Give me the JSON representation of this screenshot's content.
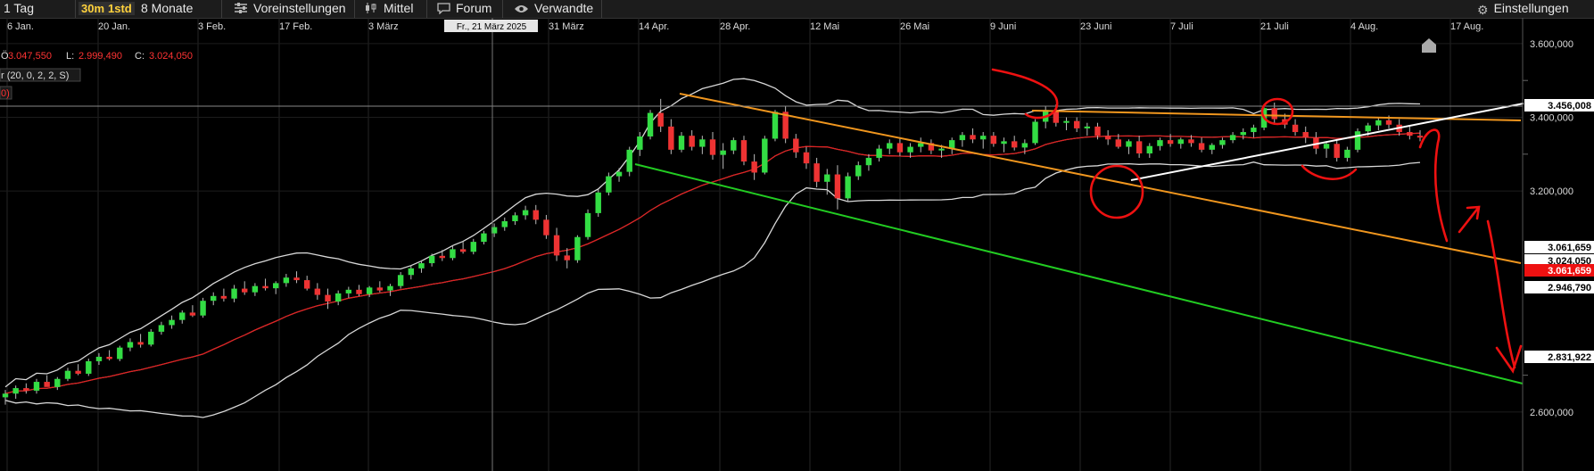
{
  "toolbar": {
    "period": "1 Tag",
    "interval_30m": "30m",
    "interval_1std": "1std",
    "range": "8 Monate",
    "presets": "Voreinstellungen",
    "indicator": "Mittel",
    "forum": "Forum",
    "related": "Verwandte",
    "settings": "Einstellungen"
  },
  "overlay": {
    "open_label": "Ö",
    "open_value": "3.047,550",
    "low_label": "L:",
    "low_value": "2.999,490",
    "close_label": "C:",
    "close_value": "3.024,050",
    "indicator_label": "r (20, 0, 2, 2, S)",
    "indicator2_label": "0)",
    "crosshair_date": "Fr., 21 März 2025"
  },
  "colors": {
    "background": "#000000",
    "bullish": "#33dd44",
    "bearish": "#ee3333",
    "bollinger": "#d8d8d8",
    "moving_average": "#dd2222",
    "orange_trend": "#f0961e",
    "green_trend": "#22cc22",
    "annotation": "#ee1111",
    "highlight_text": "#ff3333",
    "toolbar_highlight": "#ffd23c"
  },
  "chart_data": {
    "type": "candlestick",
    "x_labels": [
      "6 Jan.",
      "20 Jan.",
      "3 Feb.",
      "17 Feb.",
      "3 März",
      "31 März",
      "14 Apr.",
      "28 Apr.",
      "12 Mai",
      "26 Mai",
      "9 Juni",
      "23 Juni",
      "7 Juli",
      "21 Juli",
      "4 Aug.",
      "17 Aug."
    ],
    "y_ticks": [
      "3.600,000",
      "3.400,000",
      "3.200,000",
      "2.600,000"
    ],
    "ylim": [
      2440,
      3670
    ],
    "price_tags": [
      {
        "label": "3.456,008",
        "value": 3456.008
      },
      {
        "label": "3.061,659",
        "value": 3061.659
      },
      {
        "label": "3.024,050",
        "value": 3024.05
      },
      {
        "label": "3.061,659",
        "value": 3008.0
      },
      {
        "label": "2.946,790",
        "value": 2946.79
      },
      {
        "label": "2.831,922",
        "value": 2831.922
      }
    ],
    "candles": [
      [
        2640,
        2660,
        2620,
        2650
      ],
      [
        2650,
        2672,
        2636,
        2665
      ],
      [
        2665,
        2678,
        2650,
        2658
      ],
      [
        2658,
        2690,
        2650,
        2682
      ],
      [
        2682,
        2700,
        2670,
        2668
      ],
      [
        2668,
        2695,
        2660,
        2690
      ],
      [
        2690,
        2720,
        2684,
        2712
      ],
      [
        2712,
        2730,
        2700,
        2704
      ],
      [
        2704,
        2745,
        2698,
        2738
      ],
      [
        2738,
        2760,
        2728,
        2750
      ],
      [
        2750,
        2768,
        2740,
        2744
      ],
      [
        2744,
        2780,
        2738,
        2775
      ],
      [
        2775,
        2800,
        2765,
        2790
      ],
      [
        2790,
        2812,
        2775,
        2783
      ],
      [
        2783,
        2825,
        2778,
        2818
      ],
      [
        2818,
        2845,
        2810,
        2836
      ],
      [
        2836,
        2862,
        2826,
        2850
      ],
      [
        2850,
        2876,
        2840,
        2870
      ],
      [
        2870,
        2890,
        2858,
        2862
      ],
      [
        2862,
        2910,
        2856,
        2902
      ],
      [
        2902,
        2925,
        2890,
        2915
      ],
      [
        2915,
        2935,
        2900,
        2908
      ],
      [
        2908,
        2945,
        2898,
        2935
      ],
      [
        2935,
        2955,
        2918,
        2925
      ],
      [
        2925,
        2950,
        2915,
        2942
      ],
      [
        2942,
        2962,
        2930,
        2936
      ],
      [
        2936,
        2955,
        2920,
        2950
      ],
      [
        2950,
        2975,
        2940,
        2965
      ],
      [
        2965,
        2982,
        2950,
        2958
      ],
      [
        2958,
        2970,
        2930,
        2935
      ],
      [
        2935,
        2950,
        2905,
        2918
      ],
      [
        2918,
        2935,
        2880,
        2900
      ],
      [
        2900,
        2930,
        2890,
        2922
      ],
      [
        2922,
        2940,
        2910,
        2932
      ],
      [
        2932,
        2945,
        2915,
        2920
      ],
      [
        2920,
        2942,
        2912,
        2938
      ],
      [
        2938,
        2955,
        2925,
        2930
      ],
      [
        2930,
        2948,
        2915,
        2942
      ],
      [
        2942,
        2980,
        2935,
        2972
      ],
      [
        2972,
        2998,
        2960,
        2990
      ],
      [
        2990,
        3012,
        2978,
        3004
      ],
      [
        3004,
        3030,
        2995,
        3024
      ],
      [
        3024,
        3040,
        3010,
        3018
      ],
      [
        3018,
        3050,
        3012,
        3042
      ],
      [
        3042,
        3062,
        3030,
        3035
      ],
      [
        3035,
        3070,
        3028,
        3062
      ],
      [
        3062,
        3092,
        3055,
        3085
      ],
      [
        3085,
        3112,
        3075,
        3102
      ],
      [
        3102,
        3128,
        3092,
        3118
      ],
      [
        3118,
        3142,
        3108,
        3134
      ],
      [
        3134,
        3160,
        3122,
        3148
      ],
      [
        3148,
        3162,
        3110,
        3122
      ],
      [
        3122,
        3135,
        3070,
        3080
      ],
      [
        3080,
        3100,
        3010,
        3025
      ],
      [
        3025,
        3045,
        2990,
        3012
      ],
      [
        3012,
        3080,
        3005,
        3075
      ],
      [
        3075,
        3150,
        3068,
        3140
      ],
      [
        3140,
        3205,
        3130,
        3196
      ],
      [
        3196,
        3250,
        3188,
        3240
      ],
      [
        3240,
        3262,
        3225,
        3252
      ],
      [
        3252,
        3320,
        3240,
        3312
      ],
      [
        3312,
        3360,
        3295,
        3348
      ],
      [
        3348,
        3420,
        3340,
        3412
      ],
      [
        3412,
        3450,
        3360,
        3375
      ],
      [
        3375,
        3395,
        3300,
        3312
      ],
      [
        3312,
        3360,
        3305,
        3350
      ],
      [
        3350,
        3365,
        3310,
        3320
      ],
      [
        3320,
        3350,
        3300,
        3340
      ],
      [
        3340,
        3360,
        3285,
        3298
      ],
      [
        3298,
        3330,
        3260,
        3310
      ],
      [
        3310,
        3345,
        3300,
        3338
      ],
      [
        3338,
        3350,
        3270,
        3280
      ],
      [
        3280,
        3300,
        3230,
        3250
      ],
      [
        3250,
        3350,
        3245,
        3342
      ],
      [
        3342,
        3420,
        3335,
        3415
      ],
      [
        3415,
        3430,
        3330,
        3342
      ],
      [
        3342,
        3355,
        3290,
        3305
      ],
      [
        3305,
        3320,
        3260,
        3275
      ],
      [
        3275,
        3290,
        3210,
        3225
      ],
      [
        3225,
        3260,
        3190,
        3245
      ],
      [
        3245,
        3270,
        3150,
        3180
      ],
      [
        3180,
        3250,
        3170,
        3240
      ],
      [
        3240,
        3280,
        3230,
        3270
      ],
      [
        3270,
        3300,
        3255,
        3290
      ],
      [
        3290,
        3325,
        3280,
        3315
      ],
      [
        3315,
        3340,
        3300,
        3330
      ],
      [
        3330,
        3345,
        3295,
        3305
      ],
      [
        3305,
        3330,
        3290,
        3320
      ],
      [
        3320,
        3345,
        3305,
        3330
      ],
      [
        3330,
        3340,
        3300,
        3310
      ],
      [
        3310,
        3325,
        3290,
        3315
      ],
      [
        3315,
        3345,
        3300,
        3338
      ],
      [
        3338,
        3360,
        3320,
        3352
      ],
      [
        3352,
        3370,
        3330,
        3340
      ],
      [
        3340,
        3360,
        3315,
        3350
      ],
      [
        3350,
        3360,
        3320,
        3328
      ],
      [
        3328,
        3345,
        3305,
        3335
      ],
      [
        3335,
        3350,
        3310,
        3318
      ],
      [
        3318,
        3340,
        3300,
        3330
      ],
      [
        3330,
        3395,
        3325,
        3388
      ],
      [
        3388,
        3430,
        3370,
        3420
      ],
      [
        3420,
        3435,
        3375,
        3385
      ],
      [
        3385,
        3400,
        3365,
        3390
      ],
      [
        3390,
        3400,
        3360,
        3370
      ],
      [
        3370,
        3385,
        3350,
        3375
      ],
      [
        3375,
        3385,
        3340,
        3350
      ],
      [
        3350,
        3365,
        3325,
        3340
      ],
      [
        3340,
        3355,
        3315,
        3320
      ],
      [
        3320,
        3340,
        3300,
        3335
      ],
      [
        3335,
        3350,
        3290,
        3302
      ],
      [
        3302,
        3330,
        3290,
        3322
      ],
      [
        3322,
        3345,
        3310,
        3338
      ],
      [
        3338,
        3355,
        3320,
        3328
      ],
      [
        3328,
        3345,
        3315,
        3340
      ],
      [
        3340,
        3352,
        3320,
        3330
      ],
      [
        3330,
        3345,
        3305,
        3312
      ],
      [
        3312,
        3330,
        3300,
        3325
      ],
      [
        3325,
        3345,
        3315,
        3338
      ],
      [
        3338,
        3360,
        3330,
        3352
      ],
      [
        3352,
        3370,
        3340,
        3360
      ],
      [
        3360,
        3380,
        3345,
        3372
      ],
      [
        3372,
        3435,
        3365,
        3425
      ],
      [
        3425,
        3440,
        3385,
        3395
      ],
      [
        3395,
        3410,
        3370,
        3380
      ],
      [
        3380,
        3395,
        3350,
        3360
      ],
      [
        3360,
        3375,
        3330,
        3345
      ],
      [
        3345,
        3360,
        3300,
        3315
      ],
      [
        3315,
        3335,
        3290,
        3328
      ],
      [
        3328,
        3340,
        3280,
        3290
      ],
      [
        3290,
        3320,
        3280,
        3312
      ],
      [
        3312,
        3370,
        3305,
        3362
      ],
      [
        3362,
        3385,
        3350,
        3378
      ],
      [
        3378,
        3400,
        3365,
        3392
      ],
      [
        3392,
        3405,
        3370,
        3380
      ],
      [
        3380,
        3395,
        3350,
        3360
      ],
      [
        3360,
        3375,
        3340,
        3350
      ],
      [
        3350,
        3365,
        3335,
        3345
      ]
    ]
  }
}
